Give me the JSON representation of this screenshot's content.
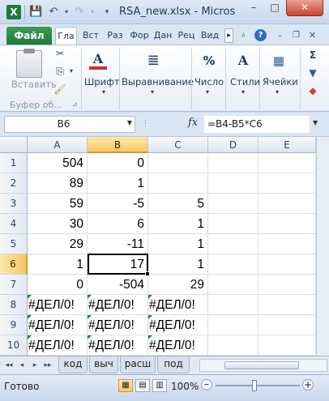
{
  "window": {
    "title": "RSA_new.xlsx - Micros",
    "app_icon": "X",
    "minimize_glyph": "–",
    "maximize_glyph": "□",
    "close_glyph": "✕"
  },
  "qat": {
    "save_icon": "floppy-icon",
    "undo_icon": "undo-icon",
    "redo_icon": "redo-icon",
    "customize_icon": "dropdown-icon"
  },
  "ribbon_tabs": {
    "file": "Файл",
    "tabs": [
      "Гла",
      "Вст",
      "Раз",
      "Фор",
      "Дан",
      "Рец",
      "Вид"
    ],
    "active_index": 0,
    "scroll_glyph": "▸"
  },
  "ribbon": {
    "paste_label": "Вставить",
    "clipboard_group": "Буфер об...",
    "font_label": "Шрифт",
    "alignment_label": "Выравнивание",
    "number_label": "Число",
    "styles_label": "Стили",
    "cells_label": "Ячейки",
    "font_icon_letter": "A",
    "number_icon": "%",
    "sigma_icon": "Σ"
  },
  "formula_bar": {
    "name_box": "B6",
    "fx": "fx",
    "formula": "=B4-B5*C6"
  },
  "grid": {
    "columns": [
      "A",
      "B",
      "C",
      "D",
      "E"
    ],
    "selected_column": "B",
    "selected_row": 6,
    "rows": [
      {
        "n": "1",
        "A": "504",
        "B": "0",
        "C": "",
        "D": "",
        "E": ""
      },
      {
        "n": "2",
        "A": "89",
        "B": "1",
        "C": "",
        "D": "",
        "E": ""
      },
      {
        "n": "3",
        "A": "59",
        "B": "-5",
        "C": "5",
        "D": "",
        "E": ""
      },
      {
        "n": "4",
        "A": "30",
        "B": "6",
        "C": "1",
        "D": "",
        "E": ""
      },
      {
        "n": "5",
        "A": "29",
        "B": "-11",
        "C": "1",
        "D": "",
        "E": ""
      },
      {
        "n": "6",
        "A": "1",
        "B": "17",
        "C": "1",
        "D": "",
        "E": ""
      },
      {
        "n": "7",
        "A": "0",
        "B": "-504",
        "C": "29",
        "D": "",
        "E": ""
      },
      {
        "n": "8",
        "A": "#ДЕЛ/0!",
        "B": "#ДЕЛ/0!",
        "C": "#ДЕЛ/0!",
        "D": "",
        "E": ""
      },
      {
        "n": "9",
        "A": "#ДЕЛ/0!",
        "B": "#ДЕЛ/0!",
        "C": "#ДЕЛ/0!",
        "D": "",
        "E": ""
      },
      {
        "n": "10",
        "A": "#ДЕЛ/0!",
        "B": "#ДЕЛ/0!",
        "C": "#ДЕЛ/0!",
        "D": "",
        "E": ""
      }
    ]
  },
  "sheets": {
    "tabs": [
      "код",
      "выч",
      "расш",
      "под"
    ],
    "nav": [
      "◂◂",
      "◂",
      "▸",
      "▸▸"
    ]
  },
  "status": {
    "ready": "Готово",
    "zoom": "100%",
    "minus": "–",
    "plus": "+"
  }
}
